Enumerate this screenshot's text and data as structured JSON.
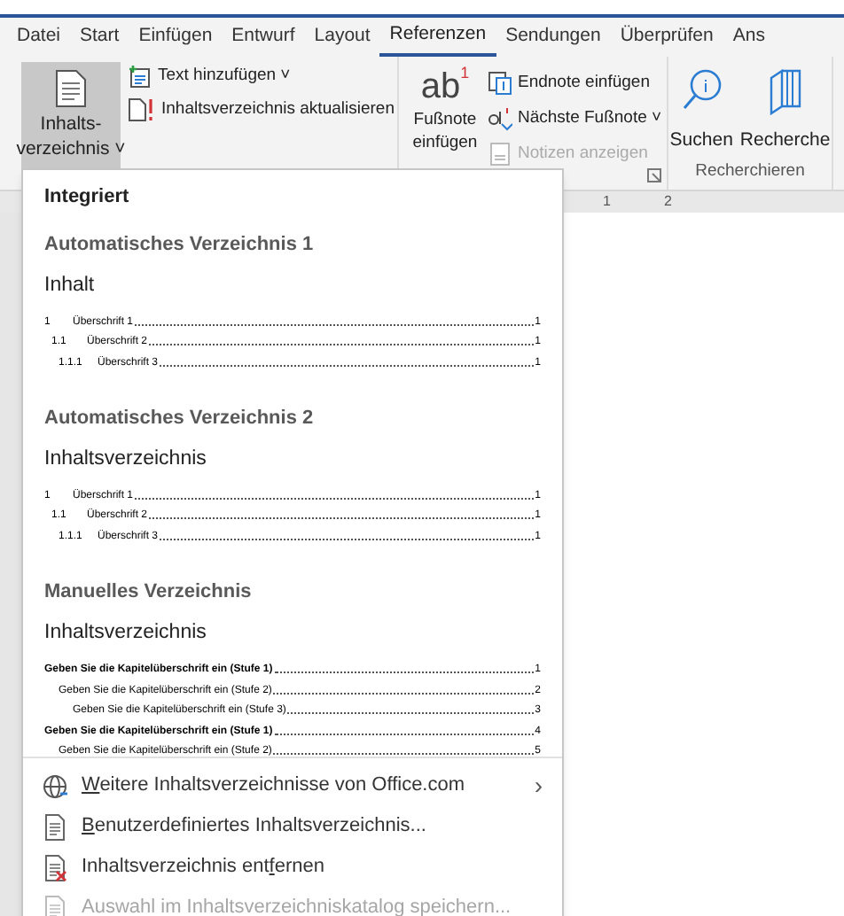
{
  "tabs": [
    {
      "label": "Datei",
      "selected": false
    },
    {
      "label": "Start",
      "selected": false
    },
    {
      "label": "Einfügen",
      "selected": false
    },
    {
      "label": "Entwurf",
      "selected": false
    },
    {
      "label": "Layout",
      "selected": false
    },
    {
      "label": "Referenzen",
      "selected": true
    },
    {
      "label": "Sendungen",
      "selected": false
    },
    {
      "label": "Überprüfen",
      "selected": false
    },
    {
      "label": "Ans",
      "selected": false
    }
  ],
  "ribbon": {
    "toc_button": {
      "line1": "Inhalts-",
      "line2": "verzeichnis",
      "caret": "˅",
      "pressed": true
    },
    "toc_small": [
      {
        "label": "Text hinzufügen",
        "caret": "˅",
        "kind": "add-text"
      },
      {
        "label": "Inhaltsverzeichnis aktualisieren",
        "kind": "update"
      }
    ],
    "footnote_button": {
      "glyph": "ab",
      "mark": "1",
      "line1": "Fußnote",
      "line2": "einfügen"
    },
    "footnote_small": [
      {
        "label": "Endnote einfügen",
        "kind": "endnote",
        "disabled": false
      },
      {
        "label": "Nächste Fußnote",
        "caret": "˅",
        "kind": "next",
        "disabled": false
      },
      {
        "label": "Notizen anzeigen",
        "kind": "notes",
        "disabled": true
      }
    ],
    "research": {
      "buttons": [
        {
          "label": "Suchen",
          "kind": "search"
        },
        {
          "label": "Recherche",
          "kind": "books"
        }
      ],
      "group_label": "Recherchieren"
    }
  },
  "ruler": {
    "marks": [
      "1",
      "2"
    ]
  },
  "dropdown": {
    "header": "Integriert",
    "sections": [
      {
        "heading": "Automatisches Verzeichnis 1",
        "title": "Inhalt",
        "kind": "numbered",
        "entries": [
          {
            "number": "1",
            "text": "Überschrift 1",
            "page": "1",
            "children": [
              {
                "number": "1.1",
                "text": "Überschrift 2",
                "page": "1",
                "children": [
                  {
                    "number": "1.1.1",
                    "text": "Überschrift 3",
                    "page": "1"
                  }
                ]
              }
            ]
          }
        ]
      },
      {
        "heading": "Automatisches Verzeichnis 2",
        "title": "Inhaltsverzeichnis",
        "kind": "numbered",
        "entries": [
          {
            "number": "1",
            "text": "Überschrift 1",
            "page": "1",
            "children": [
              {
                "number": "1.1",
                "text": "Überschrift 2",
                "page": "1",
                "children": [
                  {
                    "number": "1.1.1",
                    "text": "Überschrift 3",
                    "page": "1"
                  }
                ]
              }
            ]
          }
        ]
      },
      {
        "heading": "Manuelles Verzeichnis",
        "title": "Inhaltsverzeichnis",
        "kind": "manual",
        "entries": [
          {
            "text": "Geben Sie die Kapitelüberschrift ein (Stufe 1)",
            "page": "1",
            "children": [
              {
                "text": "Geben Sie die Kapitelüberschrift ein (Stufe 2)",
                "page": "2",
                "children": [
                  {
                    "text": "Geben Sie die Kapitelüberschrift ein (Stufe 3)",
                    "page": "3"
                  }
                ]
              }
            ]
          },
          {
            "text": "Geben Sie die Kapitelüberschrift ein (Stufe 1)",
            "page": "4",
            "children": [
              {
                "text": "Geben Sie die Kapitelüberschrift ein (Stufe 2)",
                "page": "5"
              }
            ]
          }
        ]
      }
    ],
    "menu": [
      {
        "kind": "globe",
        "label": [
          {
            "text": "W",
            "underline": true
          },
          {
            "text": "eitere Inhaltsverzeichnisse von Office.com",
            "underline": false
          }
        ],
        "submenu": "›",
        "disabled": false
      },
      {
        "kind": "custom",
        "label": [
          {
            "text": "B",
            "underline": true
          },
          {
            "text": "enutzerdefiniertes Inhaltsverzeichnis...",
            "underline": false
          }
        ],
        "disabled": false
      },
      {
        "kind": "remove",
        "label": [
          {
            "text": "Inhaltsverzeichnis ent",
            "underline": false
          },
          {
            "text": "f",
            "underline": true
          },
          {
            "text": "ernen",
            "underline": false
          }
        ],
        "disabled": false
      },
      {
        "kind": "save",
        "label": [
          {
            "text": "Auswahl im Inhaltsverzeichniskatalog speichern...",
            "underline": false
          }
        ],
        "disabled": true
      }
    ]
  }
}
